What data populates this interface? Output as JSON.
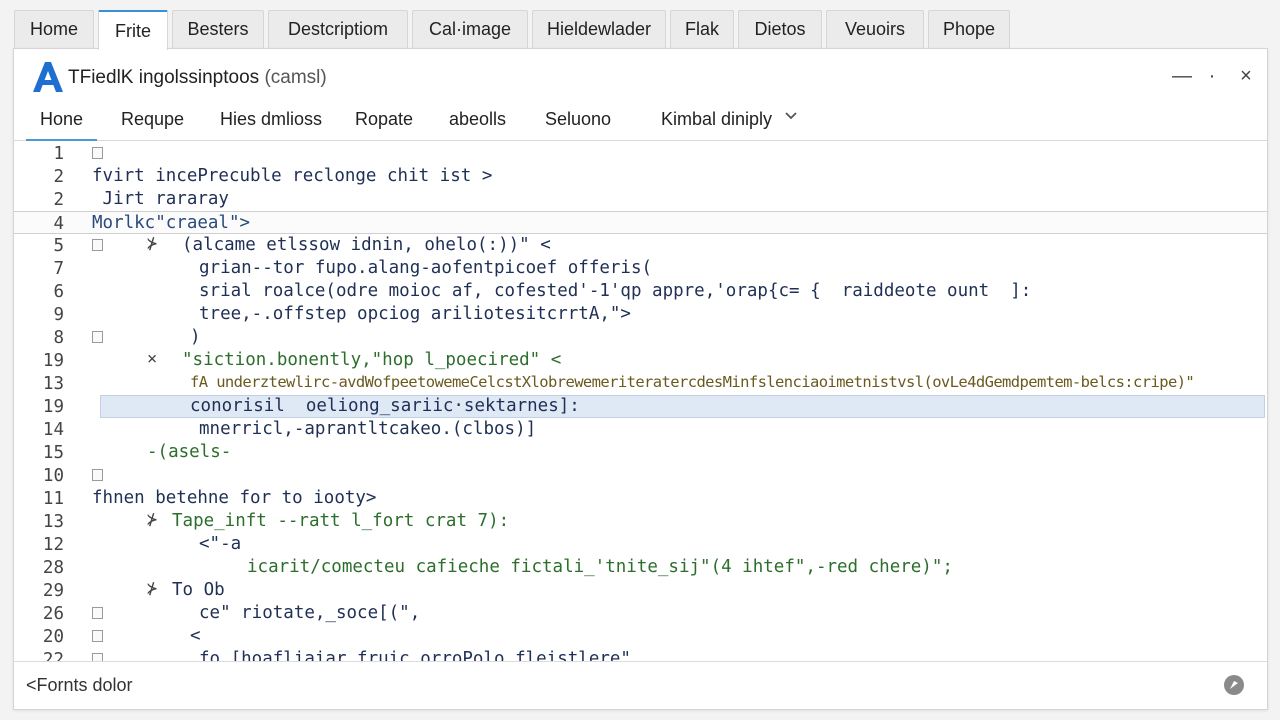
{
  "tabs": [
    {
      "label": "Home"
    },
    {
      "label": "Frite"
    },
    {
      "label": "Besters"
    },
    {
      "label": "Destcriptiom"
    },
    {
      "label": "Cal·image"
    },
    {
      "label": "Hieldewlader"
    },
    {
      "label": "Flak"
    },
    {
      "label": "Dietos"
    },
    {
      "label": "Veuoirs"
    },
    {
      "label": "Phope"
    }
  ],
  "window": {
    "title": "TFiedlK ingolssinptoos",
    "title_suffix": "(camsl)",
    "logo_letter": "A",
    "controls": {
      "minimize": "—",
      "restore": "·",
      "close": "×"
    }
  },
  "menu": [
    {
      "label": "Hone"
    },
    {
      "label": "Requpe"
    },
    {
      "label": "Hies dmlioss"
    },
    {
      "label": "Ropate"
    },
    {
      "label": "abeolls"
    },
    {
      "label": "Seluono"
    },
    {
      "label": "Kimbal diniply"
    }
  ],
  "editor": {
    "lines": [
      {
        "num": "1"
      },
      {
        "num": "2",
        "code": "fvirt incePrecuble reclonge chit ist >"
      },
      {
        "num": "2",
        "code": " Jirt rararay"
      },
      {
        "num": "4",
        "code": "Morlkc\"craeal\">"
      },
      {
        "num": "5",
        "code": "(alcame etlssow idnin, ohelo(:))\" <"
      },
      {
        "num": "7",
        "code": "grian--tor fupo.alang-aofentpicoef offeris("
      },
      {
        "num": "6",
        "code": "srial roalce(odre moioc af, cofested'-1'qp appre,'orap{c= {  raiddeote ount  ]:"
      },
      {
        "num": "9",
        "code": "tree,-.offstep opciog ariliotesitcrrtA,\">"
      },
      {
        "num": "8",
        "code": ")"
      },
      {
        "num": "19",
        "code": "\"siction.bonently,\"hop l_poecired\" <"
      },
      {
        "num": "13",
        "code": "fA underztewlirc-avdWofpeetowemeCelcstXlobrewemeriteratercdesMinfslenciaoimetnistvsl(ovLe4dGemdpemtem-belcs:cripe)\""
      },
      {
        "num": "19",
        "code": "conorisil  oeliong_sariic·sektarnes]:"
      },
      {
        "num": "14",
        "code": "mnerricl,-aprantltcakeo.(clbos)]"
      },
      {
        "num": "15",
        "code": "-(asels-"
      },
      {
        "num": "10"
      },
      {
        "num": "11",
        "code": "fhnen betehne for to iooty>"
      },
      {
        "num": "13",
        "code": "Tape_inft --ratt l_fort crat 7):"
      },
      {
        "num": "12",
        "code": "<\"-a"
      },
      {
        "num": "28",
        "code": "icarit/comecteu cafieche fictali_'tnite_sij\"(4 ihtef\",-red chere)\";"
      },
      {
        "num": "29",
        "code": "To Ob"
      },
      {
        "num": "26",
        "code": "ce\" riotate,_soce[(\","
      },
      {
        "num": "20",
        "code": "<"
      },
      {
        "num": "22",
        "code": "fo [hoafliaiar fruic orroPolo fleistlere\""
      }
    ]
  },
  "status": {
    "text": "Fornts dolor",
    "back_glyph": "<"
  },
  "colors": {
    "accent": "#3b8fd6",
    "selection": "#dfe8f5",
    "logo": "#1f6fd1"
  }
}
